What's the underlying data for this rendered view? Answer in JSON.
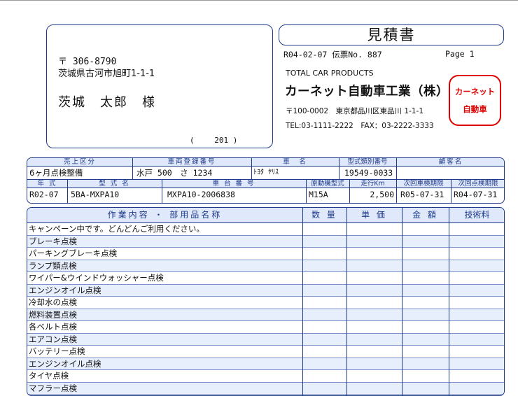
{
  "recipient": {
    "zip": "〒 306-8790",
    "address": "茨城県古河市旭町1-1-1",
    "name": "茨城　太郎　様",
    "number": "(　　 201 )"
  },
  "doc": {
    "title": "見積書",
    "date_slip": "R04-02-07 伝票No. 887",
    "page": "Page 1"
  },
  "company": {
    "name_en": "TOTAL CAR PRODUCTS",
    "name_jp": "カーネット自動車工業（株）",
    "address": "〒100-0002　東京都品川区東品川 1-1-1",
    "tel_fax": "TEL:03-1111-2222　FAX：03-2222-3333",
    "stamp_line1": "カーネット",
    "stamp_line2": "自動車",
    "stamp_color": "#e00000"
  },
  "header": {
    "labels1": {
      "sales_category": "売上区分",
      "registration": "車両登録番号",
      "car_name": "車　名",
      "model_designation": "型式類別番号",
      "customer_name": "顧客名"
    },
    "values1": {
      "sales_category": "6ヶ月点検整備",
      "registration": "水戸 500　さ 1234",
      "car_name": "ﾄﾖﾀ ﾔﾘｽ",
      "model_designation": "19549-0033",
      "customer_name": ""
    },
    "labels2": {
      "year": "年 式",
      "model": "型 式 名",
      "chassis": "車 台 番 号",
      "engine": "原動機型式",
      "mileage": "走行Km",
      "next_inspection": "次回車検期限",
      "next_check": "次回点検期限"
    },
    "values2": {
      "year": "R02-07",
      "model": "5BA-MXPA10",
      "chassis": "MXPA10-2006838",
      "engine": "M15A",
      "mileage": "2,500",
      "next_inspection": "R05-07-31",
      "next_check": "R04-07-31"
    }
  },
  "items_table": {
    "columns": {
      "work": "作業内容 ・ 部用品名称",
      "qty": "数 量",
      "unit_price": "単 価",
      "amount": "金 額",
      "labor": "技術料"
    },
    "rows": [
      "キャンペーン中です。どんどんご利用ください。",
      "ブレーキ点検",
      "パーキングブレーキ点検",
      "ランプ類点検",
      "ワイパー&ウインドウォッシャー点検",
      "エンジンオイル点検",
      "冷却水の点検",
      "燃料装置点検",
      "各ベルト点検",
      "エアコン点検",
      "バッテリー点検",
      "エンジンオイル点検",
      "タイヤ点検",
      "マフラー点検"
    ]
  }
}
